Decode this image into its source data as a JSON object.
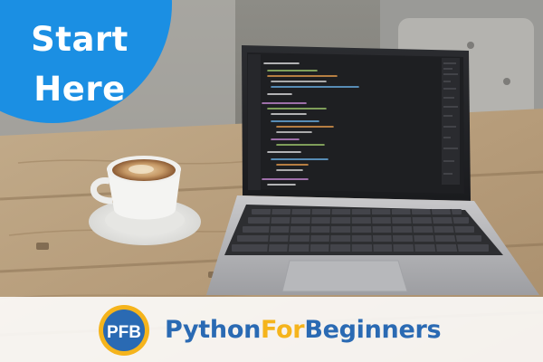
{
  "badge": {
    "line1": "Start",
    "line2": "Here",
    "color": "#1b8fe3"
  },
  "brand": {
    "part1": "Python",
    "part2": "For",
    "part3": "Beginners",
    "primary_color": "#2a6ab3",
    "accent_color": "#f5b41c"
  },
  "logo": {
    "monogram": "PFB",
    "icon": "pfb-logo-icon"
  },
  "photo": {
    "icon": "laptop-coffee-photo"
  }
}
